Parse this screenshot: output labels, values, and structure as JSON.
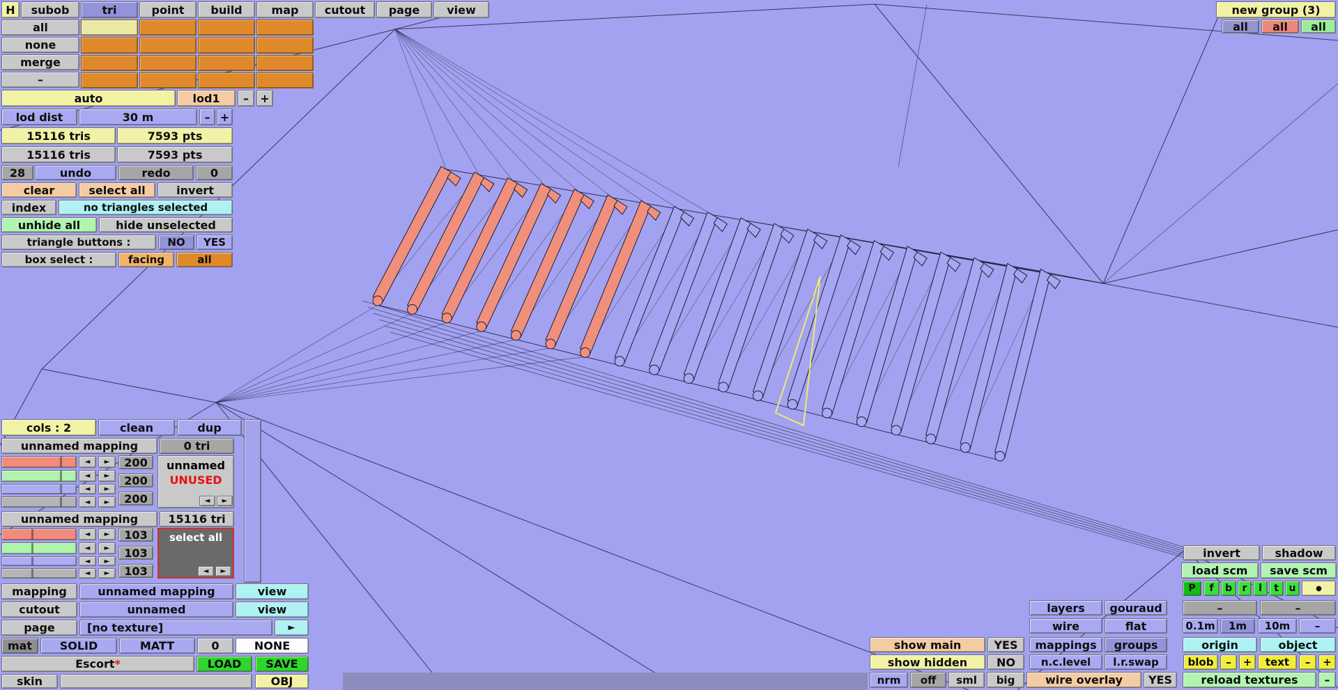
{
  "glyphs": {
    "left": "◄",
    "right": "►",
    "minus": "–",
    "plus": "+",
    "dot": "●",
    "play": "►",
    "asterisk": "*"
  },
  "toolbar": {
    "items": [
      "H",
      "subob",
      "tri",
      "point",
      "build",
      "map",
      "cutout",
      "page",
      "view"
    ]
  },
  "subobj": {
    "all": "all",
    "none": "none",
    "merge": "merge",
    "dash": "–"
  },
  "lod": {
    "auto": "auto",
    "lod1": "lod1",
    "dist_label": "lod dist",
    "dist_value": "30 m"
  },
  "stats": {
    "tris_sel": "15116 tris",
    "pts_sel": "7593 pts",
    "tris_tot": "15116 tris",
    "pts_tot": "7593 pts"
  },
  "history": {
    "undo_count": "28",
    "undo": "undo",
    "redo": "redo",
    "redo_count": "0"
  },
  "selection": {
    "clear": "clear",
    "select_all": "select all",
    "invert": "invert",
    "index": "index",
    "status": "no triangles selected",
    "unhide_all": "unhide all",
    "hide_unselected": "hide unselected",
    "tri_buttons_label": "triangle buttons :",
    "no": "NO",
    "yes": "YES",
    "box_select_label": "box select :",
    "facing": "facing",
    "all": "all"
  },
  "cols_bar": {
    "cols": "cols : 2",
    "clean": "clean",
    "dup": "dup"
  },
  "mapping1": {
    "name": "unnamed mapping",
    "tri_count": "0 tri",
    "v1": "200",
    "v2": "200",
    "v3": "200",
    "target": "unnamed",
    "status": "UNUSED"
  },
  "mapping2": {
    "name": "unnamed mapping",
    "tri_count": "15116 tri",
    "v1": "103",
    "v2": "103",
    "v3": "103",
    "action": "select all"
  },
  "bottom_left": {
    "mapping": "mapping",
    "mapping_value": "unnamed mapping",
    "view1": "view",
    "cutout": "cutout",
    "cutout_value": "unnamed",
    "view2": "view",
    "page": "page",
    "page_value": "[no texture]",
    "mat": "mat",
    "solid": "SOLID",
    "matt": "MATT",
    "zero": "0",
    "none": "NONE",
    "model_name": "Escort",
    "load": "LOAD",
    "save": "SAVE",
    "skin": "skin",
    "obj": "OBJ"
  },
  "top_right": {
    "new_group": "new group (3)",
    "all1": "all",
    "all2": "all",
    "all3": "all"
  },
  "bottom_right": {
    "invert": "invert",
    "shadow": "shadow",
    "load_scm": "load scm",
    "save_scm": "save scm",
    "proj": [
      "P",
      "f",
      "b",
      "r",
      "l",
      "t",
      "u"
    ],
    "layers": "layers",
    "gouraud": "gouraud",
    "wire": "wire",
    "flat": "flat",
    "m01": "0.1m",
    "m1": "1m",
    "m10": "10m",
    "show_main": "show main",
    "show_main_state": "YES",
    "mappings": "mappings",
    "groups": "groups",
    "origin": "origin",
    "object": "object",
    "show_hidden": "show hidden",
    "show_hidden_state": "NO",
    "nclevel": "n.c.level",
    "lrswap": "l.r.swap",
    "blob": "blob",
    "text": "text",
    "nrm": "nrm",
    "off": "off",
    "sml": "sml",
    "big": "big",
    "wire_overlay": "wire overlay",
    "wire_overlay_state": "YES",
    "reload_textures": "reload textures"
  },
  "colors": {
    "canvas": "#a2a2f0",
    "wireframe": "#1c1c38",
    "selected_tris": "#f0907c",
    "accent_orange": "#e0892a",
    "selected_blue": "#9393da",
    "highlight_triangle": "#ecec70"
  }
}
